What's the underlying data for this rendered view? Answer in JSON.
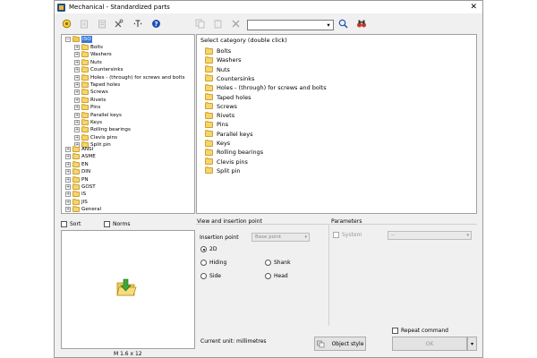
{
  "window": {
    "title": "Mechanical - Standardized parts",
    "close": "✕"
  },
  "toolbar": {
    "search_value": "",
    "dropdown_arrow": "▾"
  },
  "tree": {
    "root": {
      "label": "ISO",
      "expander": "−"
    },
    "iso_children": [
      "Bolts",
      "Washers",
      "Nuts",
      "Countersinks",
      "Holes - (through) for screws and bolts",
      "Taped holes",
      "Screws",
      "Rivets",
      "Pins",
      "Parallel keys",
      "Keys",
      "Rolling bearings",
      "Clevis pins",
      "Split pin"
    ],
    "standards": [
      "ANSI",
      "ASME",
      "EN",
      "DIN",
      "PN",
      "GOST",
      "IS",
      "JIS",
      "General"
    ],
    "expander_collapsed": "+"
  },
  "categories": {
    "header": "Select category (double click)",
    "items": [
      "Bolts",
      "Washers",
      "Nuts",
      "Countersinks",
      "Holes - (through) for screws and bolts",
      "Taped holes",
      "Screws",
      "Rivets",
      "Pins",
      "Parallel keys",
      "Keys",
      "Rolling bearings",
      "Clevis pins",
      "Split pin"
    ]
  },
  "left_options": {
    "sort": "Sort",
    "norms": "Norms"
  },
  "preview": {
    "caption": "M 1.6 x 12"
  },
  "view_insertion": {
    "title": "View and insertion point",
    "insertion_label": "Insertion point",
    "insertion_value": "Base point",
    "radios": {
      "2d": "2D",
      "hiding": "Hiding",
      "shank": "Shank",
      "side": "Side",
      "head": "Head"
    }
  },
  "parameters": {
    "title": "Parameters",
    "system": "System",
    "system_value": "--"
  },
  "footer": {
    "current_unit": "Current unit: millimetres",
    "object_style": "Object style",
    "repeat_command": "Repeat command",
    "ok": "OK"
  },
  "colors": {
    "accent": "#3a78d6",
    "folder": "#f7d56b"
  }
}
